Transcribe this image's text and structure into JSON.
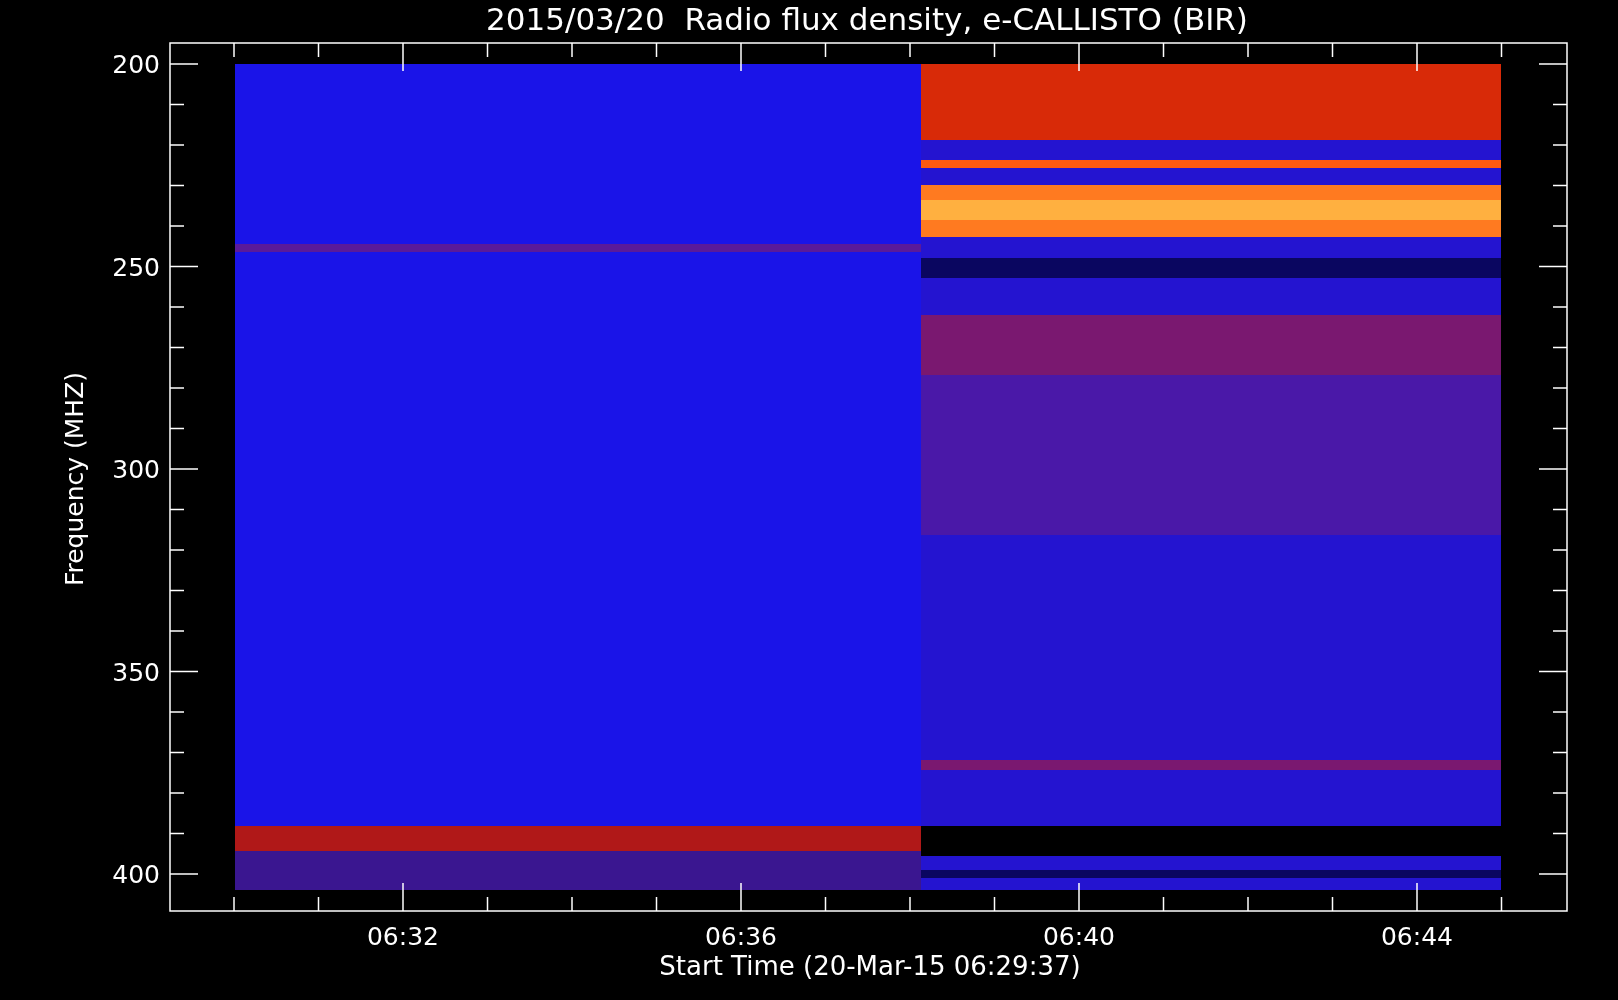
{
  "title": "2015/03/20  Radio flux density, e-CALLISTO (BIR)",
  "y_axis": {
    "label": "Frequency (MHZ)",
    "ticks": [
      "200",
      "250",
      "300",
      "350",
      "400"
    ]
  },
  "x_axis": {
    "label": "Start Time (20-Mar-15 06:29:37)",
    "ticks": [
      "06:32",
      "06:36",
      "06:40",
      "06:44"
    ]
  }
}
